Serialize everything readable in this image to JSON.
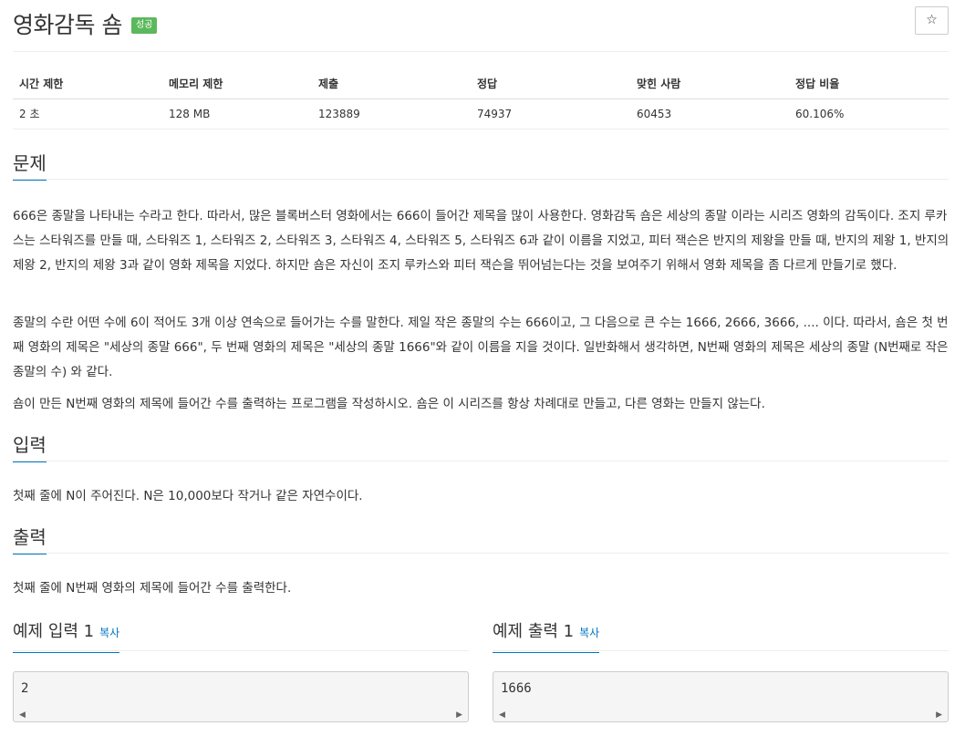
{
  "header": {
    "title": "영화감독 숌",
    "badge": "성공",
    "star": "☆"
  },
  "stats": {
    "headers": [
      "시간 제한",
      "메모리 제한",
      "제출",
      "정답",
      "맞힌 사람",
      "정답 비율"
    ],
    "values": [
      "2 초",
      "128 MB",
      "123889",
      "74937",
      "60453",
      "60.106%"
    ]
  },
  "problem": {
    "title": "문제",
    "p1": "666은 종말을 나타내는 수라고 한다. 따라서, 많은 블록버스터 영화에서는 666이 들어간 제목을 많이 사용한다. 영화감독 숌은 세상의 종말 이라는 시리즈 영화의 감독이다. 조지 루카스는 스타워즈를 만들 때, 스타워즈 1, 스타워즈 2, 스타워즈 3, 스타워즈 4, 스타워즈 5, 스타워즈 6과 같이 이름을 지었고, 피터 잭슨은 반지의 제왕을 만들 때, 반지의 제왕 1, 반지의 제왕 2, 반지의 제왕 3과 같이 영화 제목을 지었다. 하지만 숌은 자신이 조지 루카스와 피터 잭슨을 뛰어넘는다는 것을 보여주기 위해서 영화 제목을 좀 다르게 만들기로 했다.",
    "p2": "종말의 수란 어떤 수에 6이 적어도 3개 이상 연속으로 들어가는 수를 말한다. 제일 작은 종말의 수는 666이고, 그 다음으로 큰 수는 1666, 2666, 3666, .... 이다. 따라서, 숌은 첫 번째 영화의 제목은 \"세상의 종말 666\", 두 번째 영화의 제목은 \"세상의 종말 1666\"와 같이 이름을 지을 것이다. 일반화해서 생각하면, N번째 영화의 제목은 세상의 종말 (N번째로 작은 종말의 수) 와 같다.",
    "p3": "숌이 만든 N번째 영화의 제목에 들어간 수를 출력하는 프로그램을 작성하시오. 숌은 이 시리즈를 항상 차례대로 만들고, 다른 영화는 만들지 않는다."
  },
  "input": {
    "title": "입력",
    "text": "첫째 줄에 N이 주어진다. N은 10,000보다 작거나 같은 자연수이다."
  },
  "output": {
    "title": "출력",
    "text": "첫째 줄에 N번째 영화의 제목에 들어간 수를 출력한다."
  },
  "samples": {
    "input_title": "예제 입력 1",
    "output_title": "예제 출력 1",
    "copy": "복사",
    "input_value": "2",
    "output_value": "1666"
  }
}
